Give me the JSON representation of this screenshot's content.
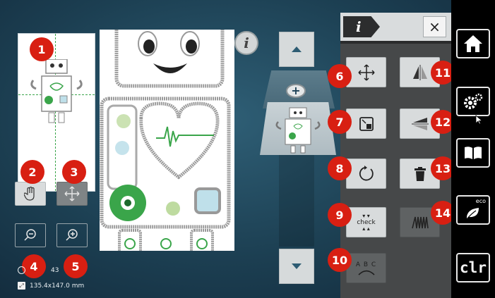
{
  "left_panel": {
    "stitch_info": "43",
    "size_readout": "135.4x147.0 mm"
  },
  "info_button": {
    "label": "i"
  },
  "edit_panel": {
    "info_tab": "i",
    "close_label": "×",
    "check_label": "check",
    "abc_label": "A B C"
  },
  "sidebar": {
    "eco_label": "eco",
    "clr_label": "clr"
  },
  "badges": [
    "1",
    "2",
    "3",
    "4",
    "5",
    "6",
    "7",
    "8",
    "9",
    "10",
    "11",
    "12",
    "13",
    "14"
  ],
  "colors": {
    "badge_red": "#d81f12",
    "embroidery_green": "#3aa54a",
    "screen_blue": "#1c3f52"
  }
}
